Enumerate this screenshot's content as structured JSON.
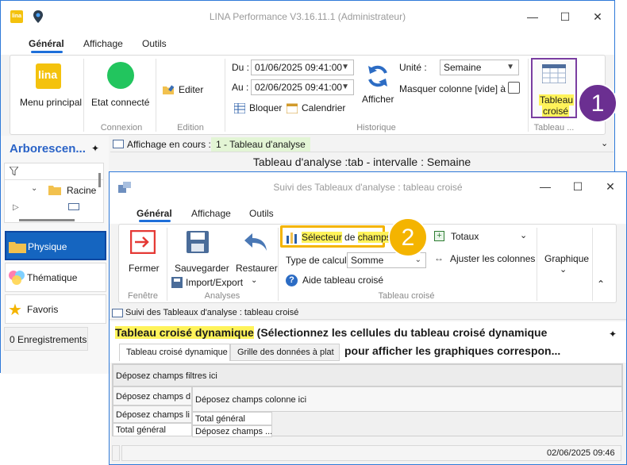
{
  "app": {
    "title": "LINA Performance  V3.16.11.1  (Administrateur)",
    "tabs": [
      "Général",
      "Affichage",
      "Outils"
    ],
    "ribbon": {
      "menu_principal": "Menu principal",
      "etat_connecte": "Etat connecté",
      "grp_connexion": "Connexion",
      "editer": "Editer",
      "grp_edition": "Edition",
      "du_label": "Du :",
      "du_value": "01/06/2025 09:41:00",
      "au_label": "Au :",
      "au_value": "02/06/2025 09:41:00",
      "bloquer": "Bloquer",
      "calendrier": "Calendrier",
      "afficher": "Afficher",
      "unite_label": "Unité :",
      "unite_value": "Semaine",
      "masquer": "Masquer colonne [vide] à 0",
      "grp_historique": "Historique",
      "tableau_croise_l1": "Tableau",
      "tableau_croise_l2": "croisé",
      "grp_tableau": "Tableau ...",
      "logo_text": "lina"
    },
    "left_panel": {
      "title": "Arborescen...",
      "tree_root": "Racine",
      "items": [
        "Physique",
        "Thématique",
        "Favoris"
      ],
      "records": "0 Enregistrements"
    },
    "affichage_label": "Affichage en cours :",
    "affichage_value": "1 - Tableau d'analyse",
    "analysis_title": "Tableau d'analyse :tab - intervalle : Semaine",
    "badge_1": "1",
    "colors": {
      "accent": "#1e6fd9",
      "highlight": "#fff35a",
      "badge1": "#6b2f91",
      "badge2": "#f4b400",
      "connected": "#22c55e"
    }
  },
  "win2": {
    "title": "Suivi des Tableaux d'analyse : tableau croisé",
    "tabs": [
      "Général",
      "Affichage",
      "Outils"
    ],
    "ribbon": {
      "fermer": "Fermer",
      "grp_fenetre": "Fenêtre",
      "sauvegarder": "Sauvegarder",
      "restaurer": "Restaurer",
      "import_export": "Import/Export",
      "grp_analyses": "Analyses",
      "selecteur_a": "Sélecteur",
      "selecteur_b": " de ",
      "selecteur_c": "champs",
      "type_calcul_label": "Type de calcul :",
      "type_calcul_value": "Somme",
      "aide": "Aide tableau croisé",
      "totaux": "Totaux",
      "ajuster": "Ajuster les colonnes",
      "grp_tableau_croise": "Tableau croisé",
      "graphique": "Graphique"
    },
    "badge_2": "2",
    "breadcrumb": "Suivi des Tableaux d'analyse : tableau croisé",
    "pivot_title_a": "Tableau croisé dynamique",
    "pivot_title_b": " (Sélectionnez les cellules du tableau croisé dynamique",
    "pivot_title_c": "pour afficher les graphiques correspon...",
    "content_tabs": [
      "Tableau croisé dynamique",
      "Grille des données à plat"
    ],
    "grid": {
      "filters": "Déposez champs filtres ici",
      "data_fields": "Déposez champs d",
      "column_fields": "Déposez champs colonne ici",
      "row_fields": "Déposez champs li",
      "total_general_col": "Total général",
      "total_general_row": "Total général",
      "drop_data": "Déposez champs ..."
    },
    "status_datetime": "02/06/2025 09:46"
  }
}
